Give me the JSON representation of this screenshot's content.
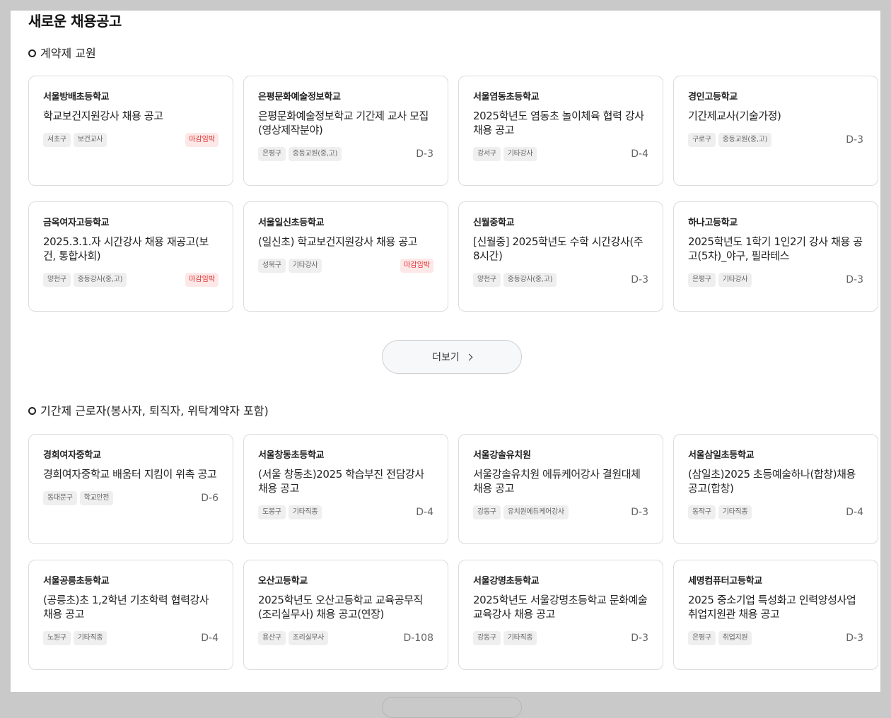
{
  "page": {
    "title": "새로운 채용공고"
  },
  "section1": {
    "heading": "계약제 교원",
    "more_label": "더보기",
    "cards": [
      {
        "school": "서울방배초등학교",
        "title": "학교보건지원강사 채용 공고",
        "tags": [
          "서초구",
          "보건교사"
        ],
        "status": "마감임박"
      },
      {
        "school": "은평문화예술정보학교",
        "title": "은평문화예술정보학교 기간제 교사 모집(영상제작분야)",
        "tags": [
          "은평구",
          "중등교원(중,고)"
        ],
        "status": "D-3"
      },
      {
        "school": "서울염동초등학교",
        "title": "2025학년도 염동초 놀이체육 협력 강사 채용 공고",
        "tags": [
          "강서구",
          "기타강사"
        ],
        "status": "D-4"
      },
      {
        "school": "경인고등학교",
        "title": "기간제교사(기술가정)",
        "tags": [
          "구로구",
          "중등교원(중,고)"
        ],
        "status": "D-3"
      },
      {
        "school": "금옥여자고등학교",
        "title": "2025.3.1.자 시간강사 채용 재공고(보건, 통합사회)",
        "tags": [
          "양천구",
          "중등강사(중,고)"
        ],
        "status": "마감임박"
      },
      {
        "school": "서울일신초등학교",
        "title": "(일신초) 학교보건지원강사 채용 공고",
        "tags": [
          "성북구",
          "기타강사"
        ],
        "status": "마감임박"
      },
      {
        "school": "신월중학교",
        "title": "[신월중] 2025학년도 수학 시간강사(주 8시간)",
        "tags": [
          "양천구",
          "중등강사(중,고)"
        ],
        "status": "D-3"
      },
      {
        "school": "하나고등학교",
        "title": "2025학년도 1학기 1인2기 강사 채용 공고(5차)_야구, 필라테스",
        "tags": [
          "은평구",
          "기타강사"
        ],
        "status": "D-3"
      }
    ]
  },
  "section2": {
    "heading": "기간제 근로자(봉사자, 퇴직자, 위탁계약자 포함)",
    "cards": [
      {
        "school": "경희여자중학교",
        "title": "경희여자중학교 배움터 지킴이 위촉 공고",
        "tags": [
          "동대문구",
          "학교안전"
        ],
        "status": "D-6"
      },
      {
        "school": "서울창동초등학교",
        "title": "(서울 창동초)2025 학습부진 전담강사 채용 공고",
        "tags": [
          "도봉구",
          "기타직종"
        ],
        "status": "D-4"
      },
      {
        "school": "서울강솔유치원",
        "title": "서울강솔유치원 에듀케어강사 결원대체 채용 공고",
        "tags": [
          "강동구",
          "유치원에듀케어강사"
        ],
        "status": "D-3"
      },
      {
        "school": "서울삼일초등학교",
        "title": "(삼일초)2025 초등예술하나(합창)채용 공고(합창)",
        "tags": [
          "동작구",
          "기타직종"
        ],
        "status": "D-4"
      },
      {
        "school": "서울공릉초등학교",
        "title": "(공릉초)초 1,2학년 기초학력 협력강사 채용 공고",
        "tags": [
          "노원구",
          "기타직종"
        ],
        "status": "D-4"
      },
      {
        "school": "오산고등학교",
        "title": "2025학년도 오산고등학교 교육공무직(조리실무사) 채용 공고(연장)",
        "tags": [
          "용산구",
          "조리실무사"
        ],
        "status": "D-108"
      },
      {
        "school": "서울강명초등학교",
        "title": "2025학년도 서울강명초등학교 문화예술교육강사 채용 공고",
        "tags": [
          "강동구",
          "기타직종"
        ],
        "status": "D-3"
      },
      {
        "school": "세명컴퓨터고등학교",
        "title": "2025 중소기업 특성화고 인력양성사업 취업지원관 채용 공고",
        "tags": [
          "은평구",
          "취업지원"
        ],
        "status": "D-3"
      }
    ]
  },
  "colors": {
    "deadline": "#e03030",
    "deadline_bg": "#fde8e8",
    "border": "#dcdcdc",
    "backdrop": "#c9c9c9"
  }
}
